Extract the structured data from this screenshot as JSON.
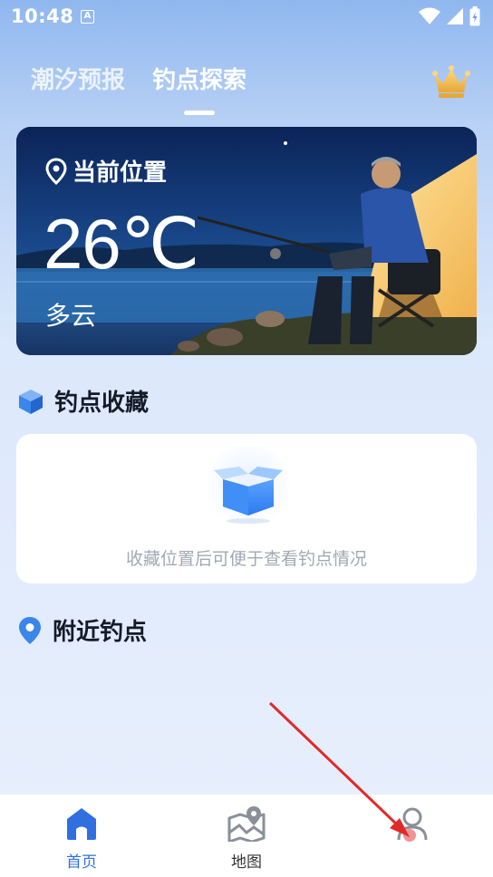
{
  "status_bar": {
    "time": "10:48",
    "notification_icon": "A"
  },
  "tabs": [
    {
      "label": "潮汐预报",
      "active": false
    },
    {
      "label": "钓点探索",
      "active": true
    }
  ],
  "weather": {
    "location_label": "当前位置",
    "temperature": "26℃",
    "condition": "多云"
  },
  "favorites": {
    "title": "钓点收藏",
    "empty_message": "收藏位置后可便于查看钓点情况"
  },
  "nearby": {
    "title": "附近钓点"
  },
  "bottom_nav": [
    {
      "label": "首页",
      "icon": "home-icon",
      "active": true
    },
    {
      "label": "地图",
      "icon": "map-icon",
      "active": false
    },
    {
      "label": "",
      "icon": "user-icon",
      "active": false
    }
  ],
  "colors": {
    "accent": "#2f6fe0",
    "annotation_arrow": "#e02a2a"
  }
}
